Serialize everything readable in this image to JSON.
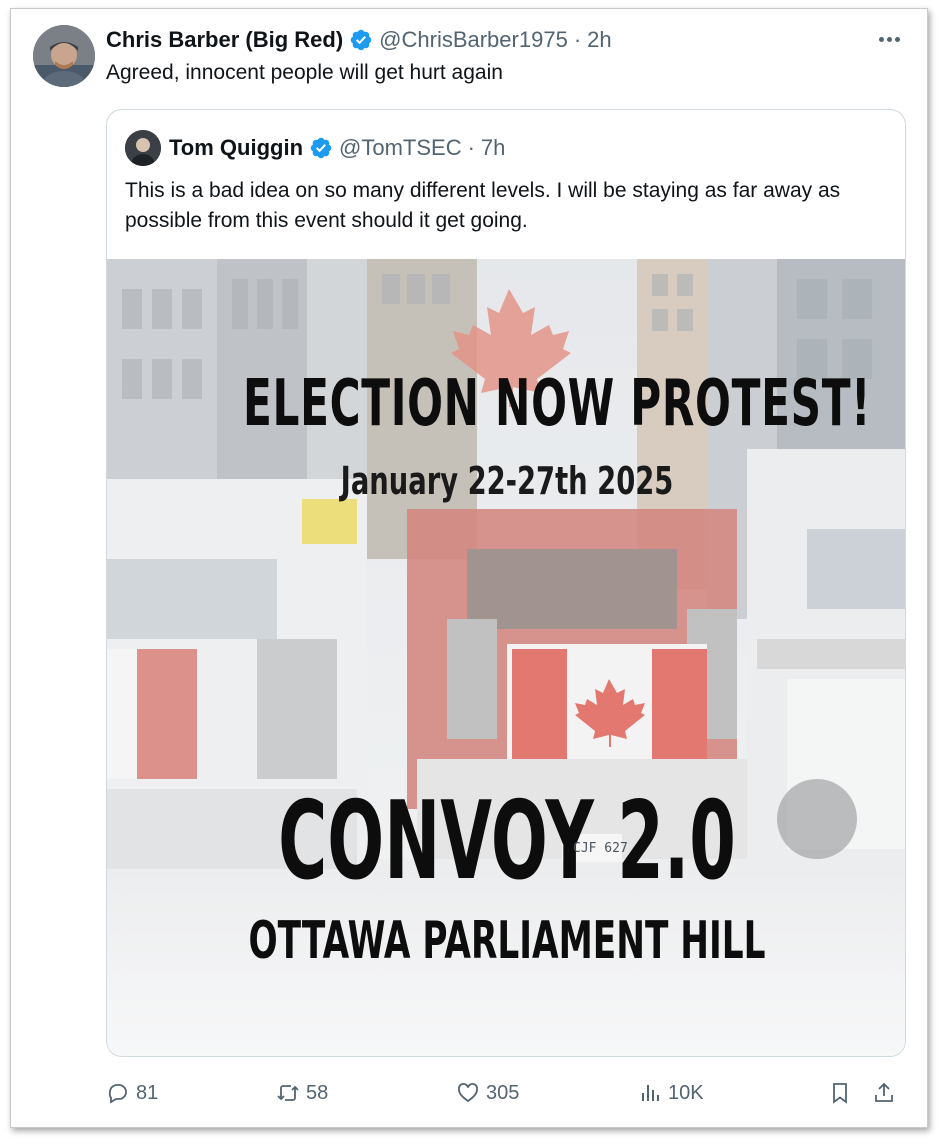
{
  "tweet": {
    "author_name": "Chris Barber (Big Red)",
    "handle": "@ChrisBarber1975",
    "separator": "·",
    "time": "2h",
    "text": "Agreed, innocent people will get hurt again",
    "avatar_icon": "user-avatar-photo",
    "verified_icon": "verified-badge-icon",
    "more_icon": "more-options-icon"
  },
  "quoted": {
    "author_name": "Tom Quiggin",
    "handle": "@TomTSEC",
    "separator": "·",
    "time": "7h",
    "text": "This is a bad idea on so many different levels.  I will be staying as far away as possible from this event should it get going.",
    "media": {
      "headline": "ELECTION NOW PROTEST!",
      "dates": "January 22-27th 2025",
      "title": "CONVOY 2.0",
      "location": "OTTAWA PARLIAMENT HILL",
      "plate": "CJF 627"
    }
  },
  "actions": {
    "replies": "81",
    "reposts": "58",
    "likes": "305",
    "views": "10K",
    "reply_icon": "reply-icon",
    "repost_icon": "repost-icon",
    "like_icon": "heart-icon",
    "views_icon": "views-icon",
    "bookmark_icon": "bookmark-icon",
    "share_icon": "share-icon"
  },
  "colors": {
    "verified_blue": "#1d9bf0",
    "text_primary": "#0f1419",
    "text_muted": "#536471",
    "canada_red": "#d52b1e"
  }
}
